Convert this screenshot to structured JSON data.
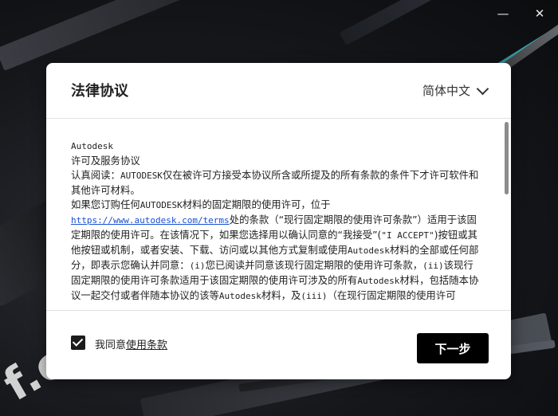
{
  "window": {
    "minimize_glyph": "—",
    "close_glyph": "✕"
  },
  "background": {
    "watermark_text": "f.c"
  },
  "dialog": {
    "title": "法律协议",
    "language": "简体中文",
    "agreement": {
      "lines": [
        {
          "t": "Autodesk",
          "mono": true
        },
        {
          "t": "许可及服务协议"
        }
      ],
      "p1_a": "认真阅读：",
      "p1_b": "AUTODESK",
      "p1_c": "仅在被许可方接受本协议所含或所提及的所有条款的条件下才许可软件和其他许可材料。",
      "p2_a": "如果您订购任何",
      "p2_b": "AUTODESK",
      "p2_c": "材料的固定期限的使用许可，位于",
      "p2_link": "https://www.autodesk.com/terms",
      "p2_d": "处的条款（“现行固定期限的使用许可条款”）适用于该固定期限的使用许可。在该情况下，如果您选择用以确认同意的“我接受”(",
      "p2_e": "\"I ACCEPT\"",
      "p2_f": ")按钮或其他按钮或机制，或者安装、下载、访问或以其他方式复制或使用",
      "p2_g": "Autodesk",
      "p2_h": "材料的全部或任何部分，即表示您确认并同意：",
      "p2_i": "(i)",
      "p2_j": "您已阅读并同意该现行固定期限的使用许可条款，",
      "p2_k": "(ii)",
      "p2_l": "该现行固定期限的使用许可条款适用于该固定期限的使用许可涉及的所有",
      "p2_m": "Autodesk",
      "p2_n": "材料，包括随本协议一起交付或者伴随本协议的该等",
      "p2_o": "Autodesk",
      "p2_p": "材料，及",
      "p2_q": "(iii)",
      "p2_r": "（在现行固定期限的使用许可"
    },
    "agree_prefix": "我同意",
    "agree_link": "使用条款",
    "agree_checked": true,
    "next_button": "下一步"
  },
  "colors": {
    "accent_cyan": "#3fc9d9",
    "primary_button": "#000000",
    "link": "#1a4fd1"
  }
}
